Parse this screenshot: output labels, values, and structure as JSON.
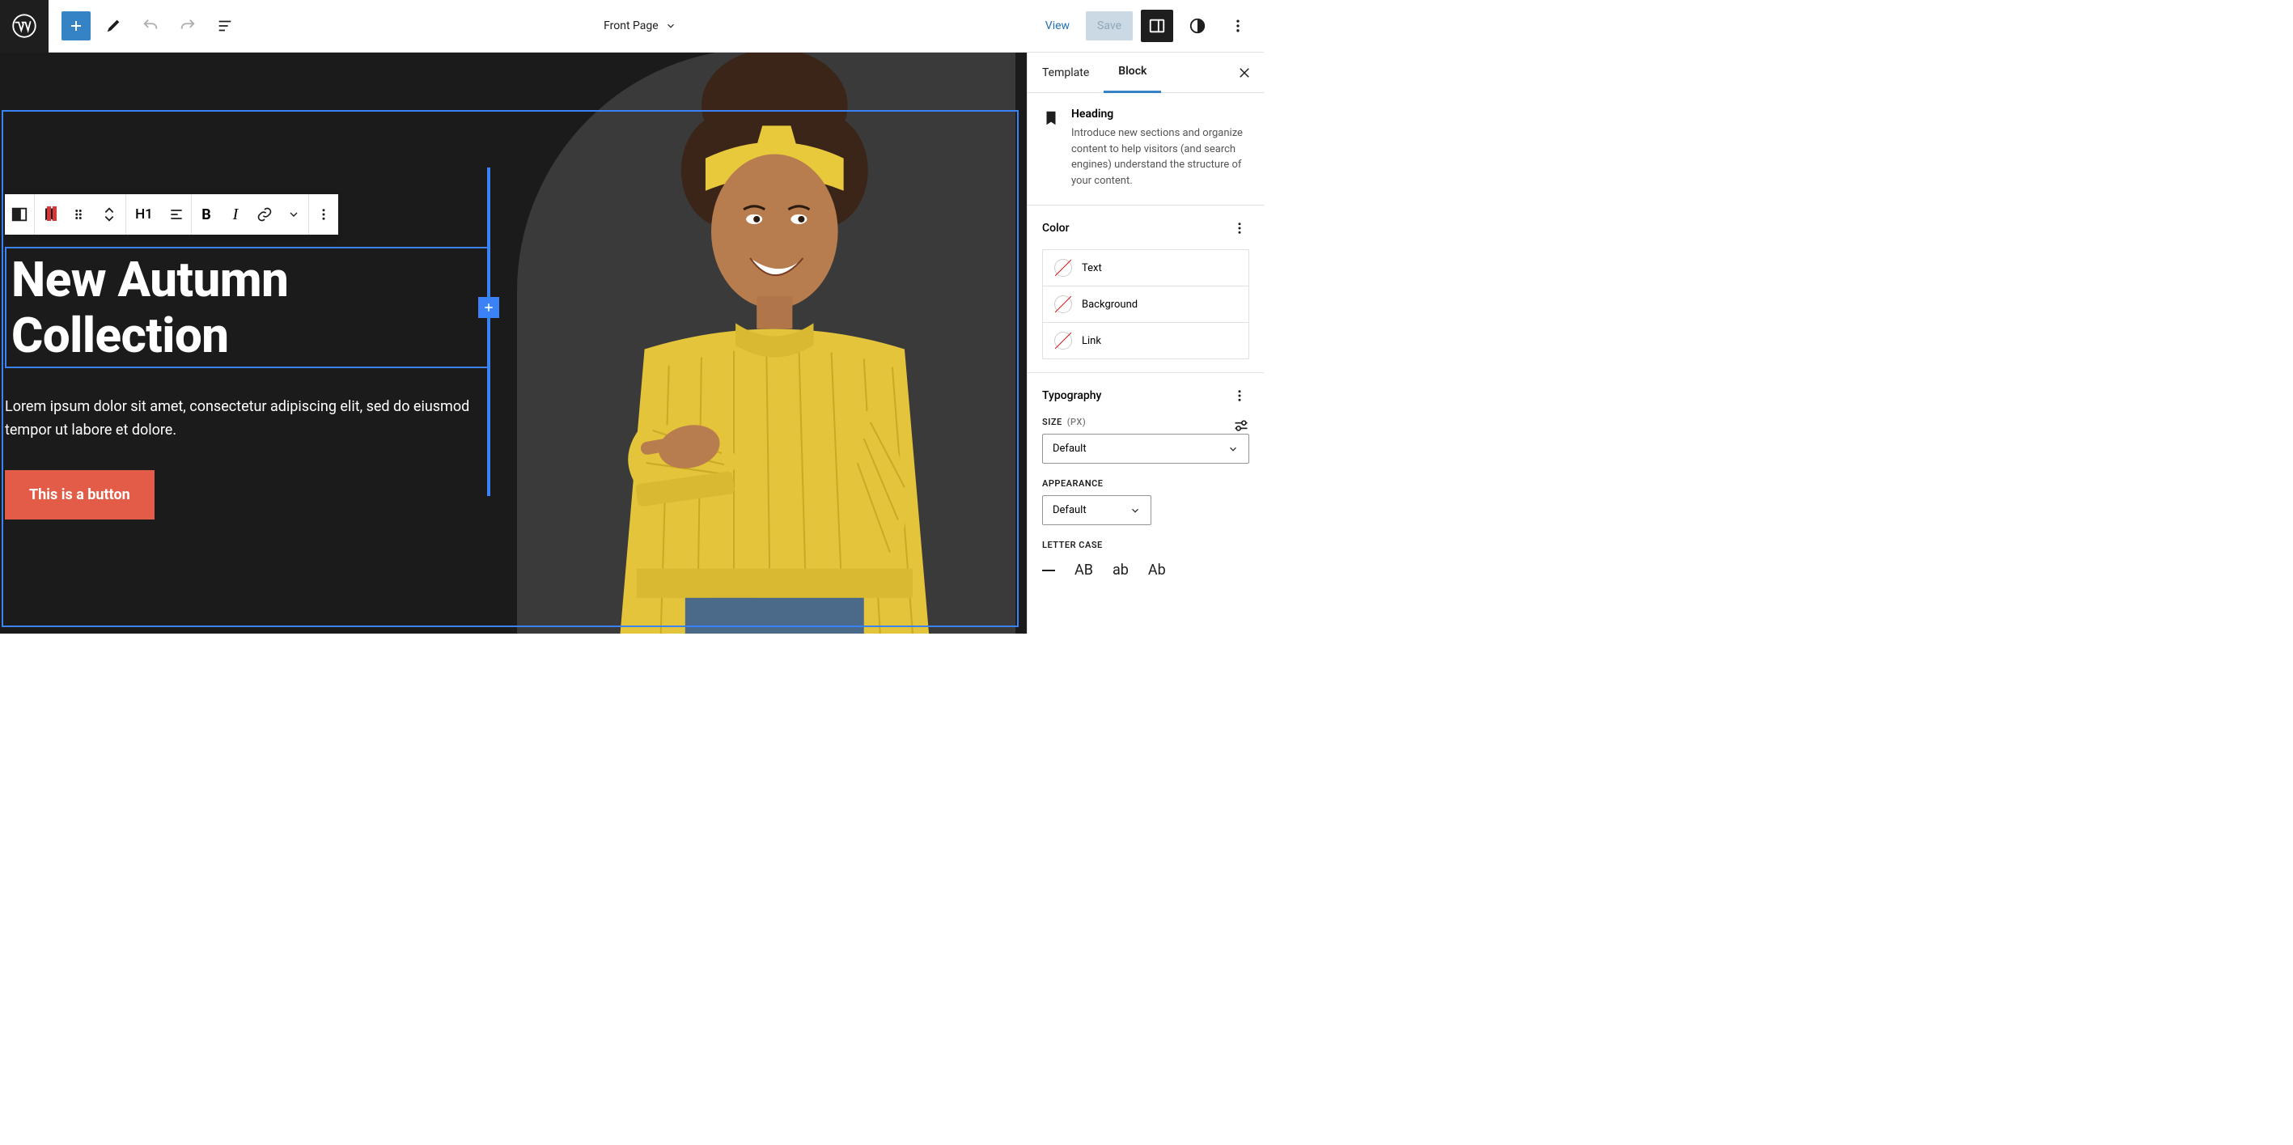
{
  "topbar": {
    "page_title": "Front Page",
    "view_label": "View",
    "save_label": "Save"
  },
  "canvas": {
    "heading": "New Autumn Collection",
    "paragraph": "Lorem ipsum dolor sit amet, consectetur adipiscing elit, sed do eiusmod tempor ut labore et dolore.",
    "button_label": "This is a button"
  },
  "float_toolbar": {
    "heading_level": "H1"
  },
  "sidebar": {
    "tabs": {
      "template": "Template",
      "block": "Block"
    },
    "block_info": {
      "title": "Heading",
      "desc": "Introduce new sections and organize content to help visitors (and search engines) understand the structure of your content."
    },
    "color": {
      "section_title": "Color",
      "items": [
        "Text",
        "Background",
        "Link"
      ]
    },
    "typography": {
      "section_title": "Typography",
      "size_label": "SIZE",
      "size_unit": "(PX)",
      "size_value": "Default",
      "appearance_label": "APPEARANCE",
      "appearance_value": "Default",
      "lettercase_label": "LETTER CASE",
      "cases": [
        "AB",
        "ab",
        "Ab"
      ]
    }
  }
}
